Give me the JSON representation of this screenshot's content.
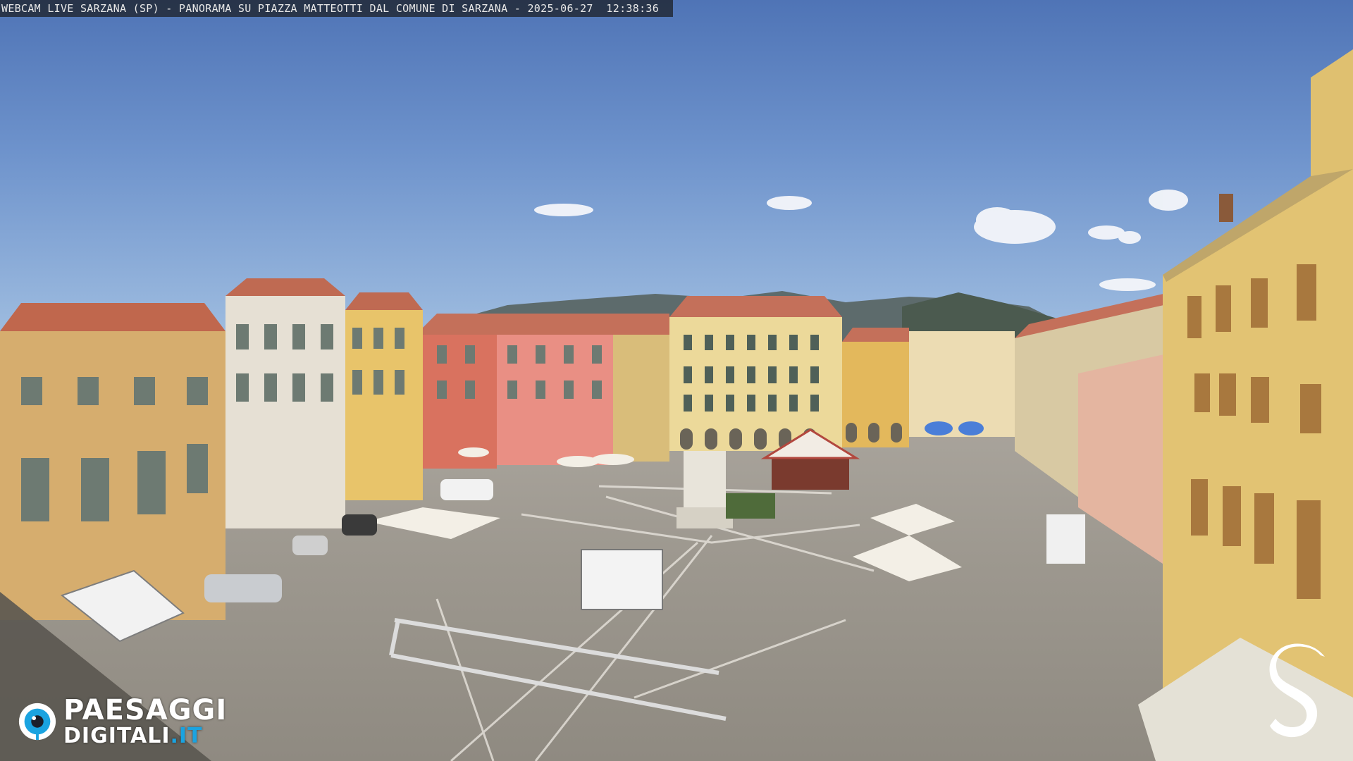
{
  "overlay": {
    "caption": "WEBCAM LIVE SARZANA (SP) - PANORAMA SU PIAZZA MATTEOTTI DAL COMUNE DI SARZANA - 2025-06-27  12:38:36"
  },
  "watermark": {
    "brand_line1": "PAESAGGI",
    "brand_line2_main": "DIGITALI",
    "brand_line2_tld": ".IT",
    "icon": "camera-lens-icon",
    "accent": "#1aa3e0"
  },
  "corner_logo": {
    "icon": "stylized-s-icon",
    "color": "#ffffff"
  },
  "scene": {
    "sky_color": "#5b80bf",
    "plaza_color": "#9d988f"
  }
}
